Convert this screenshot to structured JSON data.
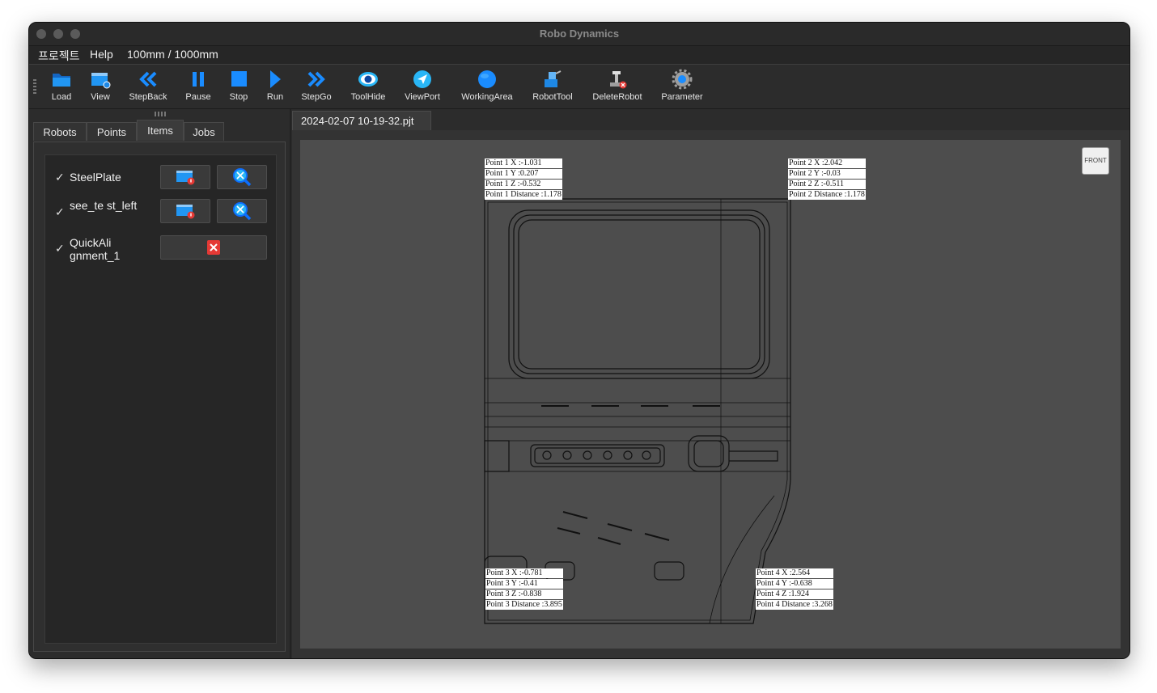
{
  "window": {
    "title": "Robo Dynamics"
  },
  "menu": {
    "items": [
      "프로젝트",
      "Help",
      "100mm / 1000mm"
    ]
  },
  "toolbar": {
    "tools": [
      {
        "label": "Load",
        "icon": "folder-icon"
      },
      {
        "label": "View",
        "icon": "view-window-icon"
      },
      {
        "label": "StepBack",
        "icon": "double-chevron-left-icon"
      },
      {
        "label": "Pause",
        "icon": "pause-icon"
      },
      {
        "label": "Stop",
        "icon": "stop-icon"
      },
      {
        "label": "Run",
        "icon": "play-icon"
      },
      {
        "label": "StepGo",
        "icon": "double-chevron-right-icon"
      },
      {
        "label": "ToolHide",
        "icon": "eye-icon"
      },
      {
        "label": "ViewPort",
        "icon": "navigate-icon"
      },
      {
        "label": "WorkingArea",
        "icon": "globe-icon"
      },
      {
        "label": "RobotTool",
        "icon": "robot-tool-icon"
      },
      {
        "label": "DeleteRobot",
        "icon": "delete-robot-icon"
      },
      {
        "label": "Parameter",
        "icon": "gear-icon"
      }
    ]
  },
  "left_panel": {
    "tabs": [
      "Robots",
      "Points",
      "Items",
      "Jobs"
    ],
    "active_tab": "Items",
    "items": [
      {
        "check": "✓",
        "label": "SteelPlate"
      },
      {
        "check": "✓",
        "label": "see_te st_left"
      },
      {
        "check": "✓",
        "label": "QuickAli gnment_1"
      }
    ]
  },
  "document": {
    "tab": "2024-02-07 10-19-32.pjt"
  },
  "viewport": {
    "cube_label": "FRONT",
    "points": [
      [
        "Point 1 X :-1.031",
        "Point 1 Y :0.207",
        "Point 1 Z :-0.532",
        "Point 1 Distance :1.178"
      ],
      [
        "Point 2 X :2.042",
        "Point 2 Y :-0.03",
        "Point 2 Z :-0.511",
        "Point 2 Distance :1.178"
      ],
      [
        "Point 3 X :-0.781",
        "Point 3 Y :-0.41",
        "Point 3 Z :-0.838",
        "Point 3 Distance :3.895"
      ],
      [
        "Point 4 X :2.564",
        "Point 4 Y :-0.638",
        "Point 4 Z :1.924",
        "Point 4 Distance :3.268"
      ]
    ]
  },
  "colors": {
    "accent_blue": "#1a8cff",
    "delete_red": "#e53935",
    "background": "#2c2c2c"
  }
}
